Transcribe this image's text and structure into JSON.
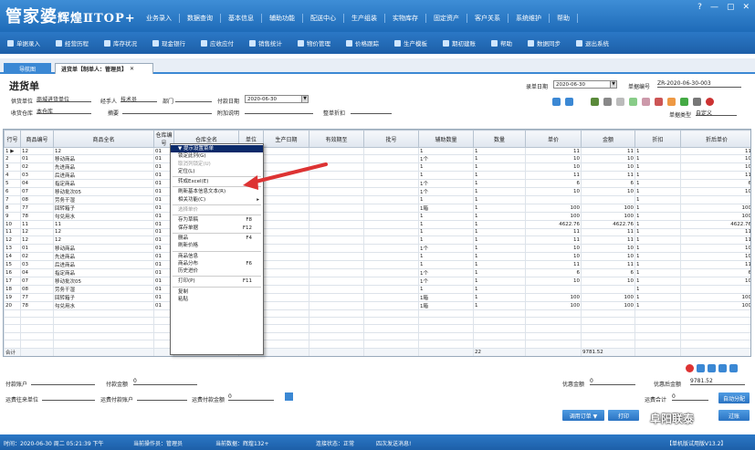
{
  "app": {
    "logo_main": "管家婆",
    "logo_sub": "辉煌ⅡTOP+"
  },
  "menu": [
    "业务录入",
    "数据查询",
    "基本信息",
    "辅助功能",
    "配送中心",
    "生产组装",
    "实物库存",
    "固定资产",
    "客户关系",
    "系统维护",
    "帮助"
  ],
  "window_buttons": [
    "?",
    "—",
    "▢",
    "✕"
  ],
  "toolbar": [
    "单据录入",
    "经营历程",
    "库存状况",
    "现金银行",
    "应收应付",
    "销售统计",
    "物价管理",
    "价格跟踪",
    "生产模板",
    "期初建账",
    "帮助",
    "数据同步",
    "退出系统"
  ],
  "tabs": {
    "home": "导航图",
    "doc": "进货单【制单人：管理员】"
  },
  "form": {
    "title": "进货单",
    "record_date_label": "录单日期",
    "record_date": "2020-06-30",
    "doc_no_label": "单据编号",
    "doc_no": "ZR-2020-06-30-003",
    "supplier_label": "供货单位",
    "supplier": "商城进货单位",
    "handler_label": "经手人",
    "handler": "技术员",
    "dept_label": "部门",
    "dept": "",
    "pay_date_label": "付款日期",
    "pay_date": "2020-06-30",
    "warehouse_label": "收货仓库",
    "warehouse": "本仓库",
    "summary_label": "摘要",
    "note_label": "附加说明",
    "discount_label": "整单折扣",
    "doc_type_label": "单据类型",
    "doc_type": "自定义"
  },
  "grid": {
    "headers": [
      "行号",
      "商品编号",
      "商品全名",
      "仓库编号",
      "仓库全名",
      "单位",
      "生产日期",
      "有效期至",
      "批号",
      "辅助数量",
      "数量",
      "单价",
      "金额",
      "折扣",
      "折后单价"
    ],
    "rows": [
      [
        "1",
        "12",
        "12",
        "01",
        "",
        "",
        "",
        "",
        "",
        "1",
        "1",
        "11",
        "11",
        "1",
        "11"
      ],
      [
        "2",
        "01",
        "移动商品",
        "01",
        "",
        "",
        "",
        "",
        "",
        "1个",
        "1",
        "10",
        "10",
        "1",
        "10"
      ],
      [
        "3",
        "02",
        "先进商品",
        "01",
        "",
        "",
        "",
        "",
        "",
        "1",
        "1",
        "10",
        "10",
        "1",
        "10"
      ],
      [
        "4",
        "03",
        "后进商品",
        "01",
        "",
        "",
        "",
        "",
        "",
        "1",
        "1",
        "11",
        "11",
        "1",
        "11"
      ],
      [
        "5",
        "04",
        "指定商品",
        "01",
        "",
        "",
        "",
        "",
        "",
        "1个",
        "1",
        "6",
        "6",
        "1",
        "6"
      ],
      [
        "6",
        "07",
        "移动批次05",
        "01",
        "",
        "",
        "",
        "",
        "",
        "1个",
        "1",
        "10",
        "10",
        "1",
        "10"
      ],
      [
        "7",
        "08",
        "劳务干湿",
        "01",
        "",
        "",
        "",
        "",
        "",
        "1",
        "1",
        "",
        "",
        "1",
        ""
      ],
      [
        "8",
        "77",
        "回转箱子",
        "01",
        "",
        "",
        "",
        "",
        "",
        "1箱",
        "1",
        "100",
        "100",
        "1",
        "100"
      ],
      [
        "9",
        "78",
        "勾兑用水",
        "01",
        "",
        "",
        "",
        "",
        "",
        "1",
        "1",
        "100",
        "100",
        "1",
        "100"
      ],
      [
        "10",
        "11",
        "11",
        "01",
        "",
        "",
        "",
        "",
        "",
        "1",
        "1",
        "4622.76",
        "4622.76",
        "1",
        "4622.76"
      ],
      [
        "11",
        "12",
        "12",
        "01",
        "",
        "",
        "",
        "",
        "",
        "1",
        "1",
        "11",
        "11",
        "1",
        "11"
      ],
      [
        "12",
        "12",
        "12",
        "01",
        "",
        "",
        "",
        "",
        "",
        "1",
        "1",
        "11",
        "11",
        "1",
        "11"
      ],
      [
        "13",
        "01",
        "移动商品",
        "01",
        "",
        "",
        "",
        "",
        "",
        "1个",
        "1",
        "10",
        "10",
        "1",
        "10"
      ],
      [
        "14",
        "02",
        "先进商品",
        "01",
        "",
        "",
        "",
        "",
        "",
        "1",
        "1",
        "10",
        "10",
        "1",
        "10"
      ],
      [
        "15",
        "03",
        "后进商品",
        "01",
        "",
        "",
        "",
        "",
        "",
        "1",
        "1",
        "11",
        "11",
        "1",
        "11"
      ],
      [
        "16",
        "04",
        "指定商品",
        "01",
        "",
        "",
        "",
        "",
        "",
        "1个",
        "1",
        "6",
        "6",
        "1",
        "6"
      ],
      [
        "17",
        "07",
        "移动批次05",
        "01",
        "",
        "",
        "",
        "",
        "",
        "1个",
        "1",
        "10",
        "10",
        "1",
        "10"
      ],
      [
        "18",
        "08",
        "劳务干湿",
        "01",
        "",
        "",
        "",
        "",
        "",
        "1",
        "1",
        "",
        "",
        "1",
        ""
      ],
      [
        "19",
        "77",
        "回转箱子",
        "01",
        "",
        "",
        "",
        "",
        "",
        "1箱",
        "1",
        "100",
        "100",
        "1",
        "100"
      ],
      [
        "20",
        "78",
        "勾兑用水",
        "01",
        "",
        "",
        "",
        "",
        "",
        "1箱",
        "1",
        "100",
        "100",
        "1",
        "100"
      ]
    ],
    "sum_label": "合计",
    "sum_qty": "22",
    "sum_amount": "9781.52"
  },
  "context_menu": [
    {
      "label": "▼ 提示设置菜单",
      "hl": true
    },
    {
      "label": "锁定此列(G)"
    },
    {
      "label": "取消列锁定(U)",
      "dis": true
    },
    {
      "label": "定位(L)"
    },
    {
      "sep": true
    },
    {
      "label": "转成Excel(E)"
    },
    {
      "sep": true
    },
    {
      "label": "刷新基本信息文本(R)"
    },
    {
      "label": "相关功能(C)",
      "arrow": true
    },
    {
      "sep": true
    },
    {
      "label": "选择单价",
      "dis": true
    },
    {
      "sep": true
    },
    {
      "label": "存为草稿",
      "sc": "F8"
    },
    {
      "label": "保存单据",
      "sc": "F12"
    },
    {
      "sep": true
    },
    {
      "label": "删品",
      "sc": "F4"
    },
    {
      "label": "刷新价格"
    },
    {
      "sep": true
    },
    {
      "label": "商品信息"
    },
    {
      "label": "商品分布",
      "sc": "F6"
    },
    {
      "label": "历史进价"
    },
    {
      "sep": true
    },
    {
      "label": "打印(P)",
      "sc": "F11"
    },
    {
      "sep": true
    },
    {
      "label": "复制"
    },
    {
      "label": "粘贴"
    }
  ],
  "bottom": {
    "pay_account_label": "付款账户",
    "pay_amount_label": "付款金额",
    "pay_amount": "0",
    "freight_unit_label": "运费往来单位",
    "freight_account_label": "运费付款账户",
    "freight_amount_label": "运费付款金额",
    "freight_amount": "0",
    "discount_amount_label": "优惠金额",
    "discount_amount": "0",
    "after_discount_label": "优惠后金额",
    "after_discount": "9781.52",
    "freight_total_label": "运费合计",
    "freight_total": "0",
    "auto_split": "自动分配",
    "btn_order": "调用订单 ▼",
    "btn_print": "打印",
    "btn_post": "过账"
  },
  "status": {
    "time": "时间：2020-06-30 周二 05:21:39 下午",
    "operator": "当前操作员：管理员",
    "version": "当前数据：辉煌132+",
    "conn": "连接状态：正常",
    "msg": "四次发送消息!",
    "edition": "【单机版试用版V13.2】"
  },
  "watermark": "阜阳联泰"
}
